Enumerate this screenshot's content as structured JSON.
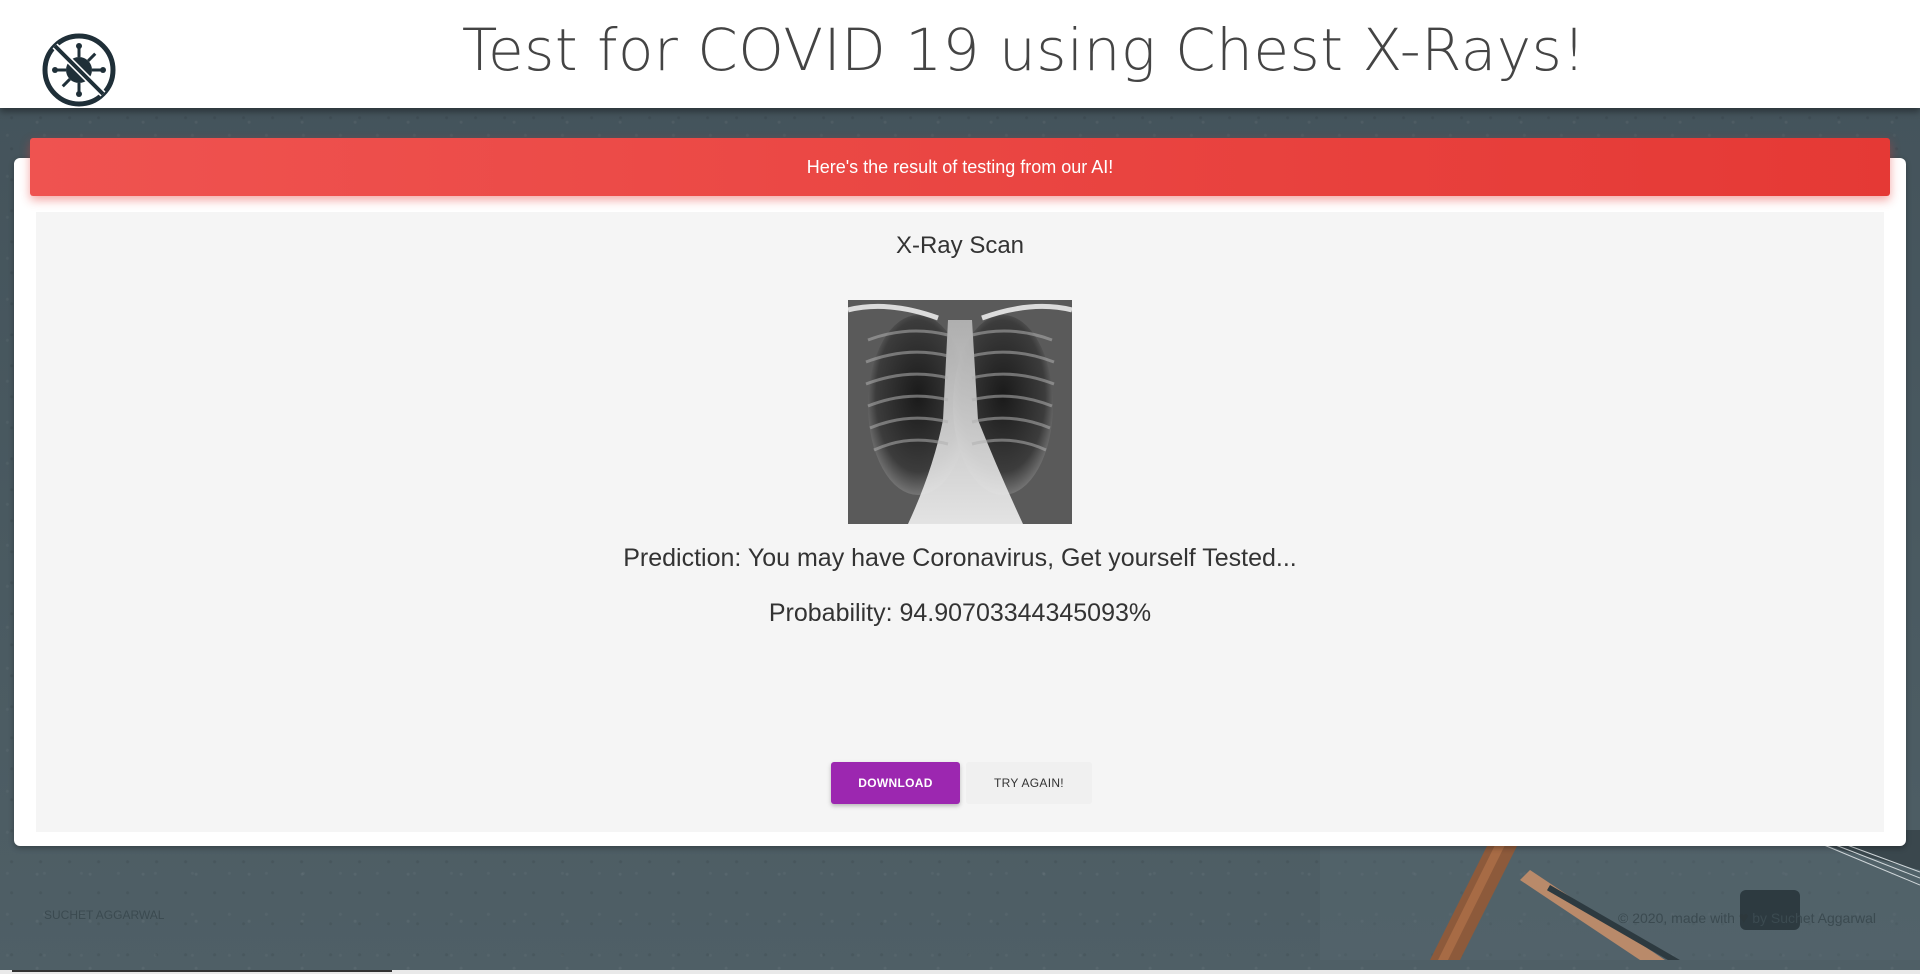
{
  "header": {
    "title": "Test for COVID 19 using Chest X-Rays!",
    "logo_icon": "no-virus-icon"
  },
  "result": {
    "banner": "Here's the result of testing from our AI!",
    "scan_title": "X-Ray Scan",
    "image_icon": "chest-xray-image",
    "prediction": "Prediction: You may have Coronavirus, Get yourself Tested...",
    "probability": "Probability: 94.90703344345093%"
  },
  "actions": {
    "download_label": "DOWNLOAD",
    "try_again_label": "TRY AGAIN!"
  },
  "footer": {
    "left": "SUCHET AGGARWAL",
    "right_prefix": "© 2020, made with",
    "heart": "♥",
    "right_suffix": "by Suchet Aggarwal"
  },
  "colors": {
    "banner": "#e53935",
    "download_button": "#9c27b0",
    "background": "#47565c"
  }
}
